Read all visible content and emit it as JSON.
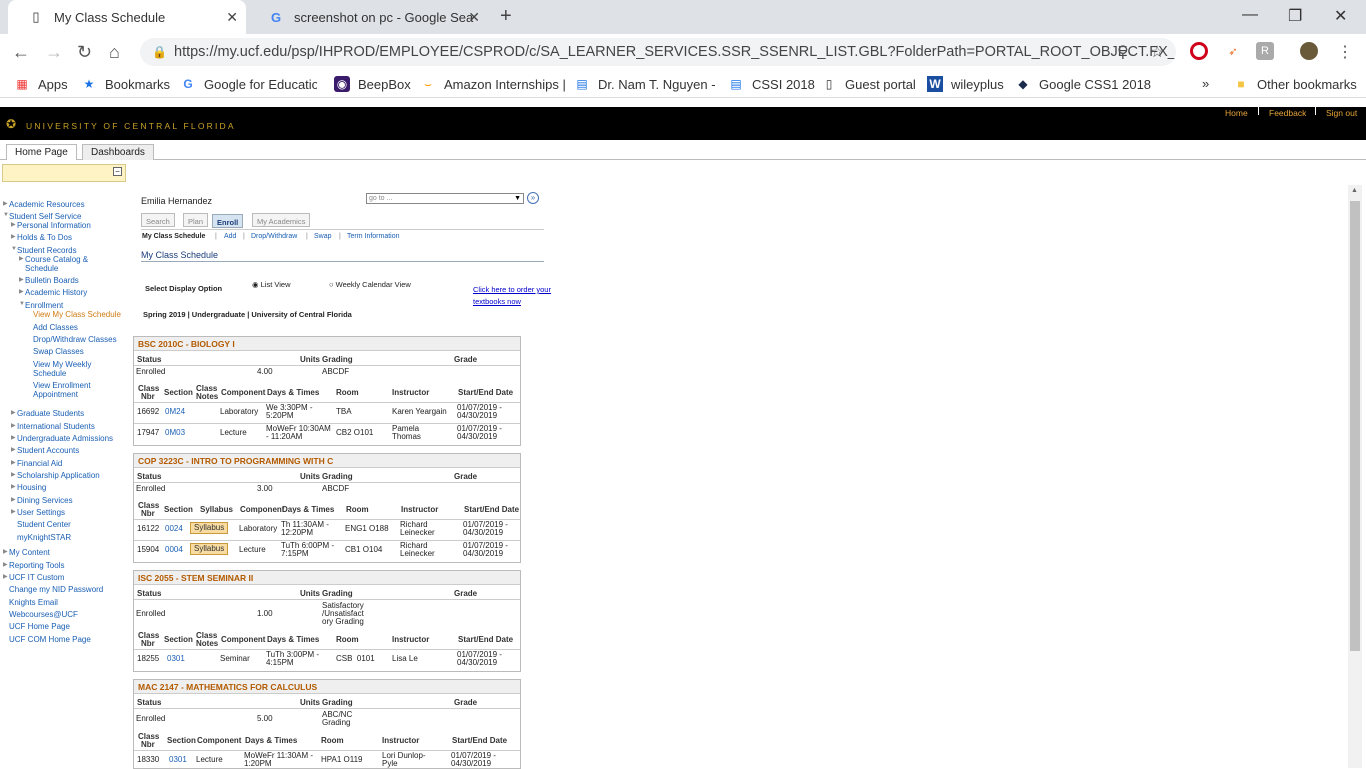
{
  "browser": {
    "tabs": [
      {
        "title": "My Class Schedule",
        "icon": "page-icon"
      },
      {
        "title": "screenshot on pc - Google Search",
        "icon": "google-icon"
      }
    ],
    "new_tab": "+",
    "url": "https://my.ucf.edu/psp/IHPROD/EMPLOYEE/CSPROD/c/SA_LEARNER_SERVICES.SSR_SSENRL_LIST.GBL?FolderPath=PORTAL_ROOT_OBJECT.FX_STUDE...",
    "bookmarks": [
      {
        "label": "Apps",
        "icon": "apps-icon"
      },
      {
        "label": "Bookmarks",
        "icon": "star-icon"
      },
      {
        "label": "Google for Education",
        "icon": "google-icon"
      },
      {
        "label": "BeepBox",
        "icon": "beepbox-icon"
      },
      {
        "label": "Amazon Internships |",
        "icon": "amazon-icon"
      },
      {
        "label": "Dr. Nam T. Nguyen -",
        "icon": "calendar-icon"
      },
      {
        "label": "CSSI 2018",
        "icon": "calendar-icon"
      },
      {
        "label": "Guest portal",
        "icon": "page-icon"
      },
      {
        "label": "wileyplus",
        "icon": "w-icon"
      },
      {
        "label": "Google CSS1 2018 -",
        "icon": "diamond-icon"
      }
    ],
    "bookmarks_overflow": "»",
    "other_bookmarks": "Other bookmarks"
  },
  "portal": {
    "university": "UNIVERSITY OF CENTRAL FLORIDA",
    "header_links": [
      "Home",
      "Feedback",
      "Sign out"
    ],
    "tabs": [
      "Home Page",
      "Dashboards"
    ]
  },
  "nav": [
    {
      "label": "Academic Resources"
    },
    {
      "label": "Student Self Service"
    },
    {
      "label": "Personal Information"
    },
    {
      "label": "Holds & To Dos"
    },
    {
      "label": "Student Records"
    },
    {
      "label": "Course Catalog &"
    },
    {
      "label": "Schedule"
    },
    {
      "label": "Bulletin Boards"
    },
    {
      "label": "Academic History"
    },
    {
      "label": "Enrollment"
    },
    {
      "label": "View My Class Schedule"
    },
    {
      "label": "Add Classes"
    },
    {
      "label": "Drop/Withdraw Classes"
    },
    {
      "label": "Swap Classes"
    },
    {
      "label": "View My Weekly"
    },
    {
      "label": "Schedule"
    },
    {
      "label": "View Enrollment"
    },
    {
      "label": "Appointment"
    },
    {
      "label": "Graduate Students"
    },
    {
      "label": "International Students"
    },
    {
      "label": "Undergraduate Admissions"
    },
    {
      "label": "Student Accounts"
    },
    {
      "label": "Financial Aid"
    },
    {
      "label": "Scholarship Application"
    },
    {
      "label": "Housing"
    },
    {
      "label": "Dining Services"
    },
    {
      "label": "User Settings"
    },
    {
      "label": "Student Center"
    },
    {
      "label": "myKnightSTAR"
    },
    {
      "label": "My Content"
    },
    {
      "label": "Reporting Tools"
    },
    {
      "label": "UCF IT Custom"
    },
    {
      "label": "Change my NID Password"
    },
    {
      "label": "Knights Email"
    },
    {
      "label": "Webcourses@UCF"
    },
    {
      "label": "UCF Home Page"
    },
    {
      "label": "UCF COM Home Page"
    }
  ],
  "main": {
    "student_name": "Emilia Hernandez",
    "goto_placeholder": "go to ...",
    "tabs": [
      "Search",
      "Plan",
      "Enroll",
      "My Academics"
    ],
    "sublinks": [
      "My Class Schedule",
      "Add",
      "Drop/Withdraw",
      "Swap",
      "Term Information"
    ],
    "sublink_sep": "|",
    "page_title": "My Class Schedule",
    "display_option_label": "Select Display Option",
    "list_view": "List View",
    "weekly_view": "Weekly Calendar View",
    "textbook_link_1": "Click here to order your",
    "textbook_link_2": "textbooks now",
    "term": "Spring 2019 | Undergraduate | University of Central Florida"
  },
  "labels": {
    "status": "Status",
    "units": "Units",
    "grading": "Grading",
    "grade": "Grade",
    "class": "Class",
    "nbr": "Nbr",
    "section": "Section",
    "class_notes_1": "Class",
    "class_notes_2": "Notes",
    "syllabus": "Syllabus",
    "component": "Component",
    "days_times": "Days & Times",
    "room": "Room",
    "instructor": "Instructor",
    "start_end": "Start/End Date"
  },
  "courses": [
    {
      "title": "BSC 2010C - BIOLOGY I",
      "status": "Enrolled",
      "units": "4.00",
      "grading": "ABCDF",
      "classes": [
        {
          "nbr": "16692",
          "section": "0M24",
          "component": "Laboratory",
          "days1": "We 3:30PM -",
          "days2": "5:20PM",
          "room": "TBA",
          "instr1": "Karen Yeargain",
          "instr2": "",
          "date1": "01/07/2019 -",
          "date2": "04/30/2019"
        },
        {
          "nbr": "17947",
          "section": "0M03",
          "component": "Lecture",
          "days1": "MoWeFr 10:30AM",
          "days2": "- 11:20AM",
          "room": "CB2 O101",
          "instr1": "Pamela",
          "instr2": "Thomas",
          "date1": "01/07/2019 -",
          "date2": "04/30/2019"
        }
      ]
    },
    {
      "title": "COP 3223C - INTRO TO PROGRAMMING WITH C",
      "status": "Enrolled",
      "units": "3.00",
      "grading": "ABCDF",
      "classes": [
        {
          "nbr": "16122",
          "section": "0024",
          "component": "Laboratory",
          "days1": "Th 11:30AM -",
          "days2": "12:20PM",
          "room": "ENG1 O188",
          "instr1": "Richard",
          "instr2": "Leinecker",
          "date1": "01/07/2019 -",
          "date2": "04/30/2019"
        },
        {
          "nbr": "15904",
          "section": "0004",
          "component": "Lecture",
          "days1": "TuTh 6:00PM -",
          "days2": "7:15PM",
          "room": "CB1 O104",
          "instr1": "Richard",
          "instr2": "Leinecker",
          "date1": "01/07/2019 -",
          "date2": "04/30/2019"
        }
      ]
    },
    {
      "title": "ISC 2055 - STEM SEMINAR II",
      "status": "Enrolled",
      "units": "1.00",
      "grading1": "Satisfactory",
      "grading2": "/Unsatisfact",
      "grading3": "ory Grading",
      "classes": [
        {
          "nbr": "18255",
          "section": "0301",
          "component": "Seminar",
          "days1": "TuTh 3:00PM -",
          "days2": "4:15PM",
          "room": "CSB  0101",
          "instr1": "Lisa Le",
          "instr2": "",
          "date1": "01/07/2019 -",
          "date2": "04/30/2019"
        }
      ]
    },
    {
      "title": "MAC 2147 - MATHEMATICS FOR CALCULUS",
      "status": "Enrolled",
      "units": "5.00",
      "grading1": "ABC/NC",
      "grading2": "Grading",
      "classes": [
        {
          "nbr": "18330",
          "section": "0301",
          "component": "Lecture",
          "days1": "MoWeFr 11:30AM -",
          "days2": "1:20PM",
          "room": "HPA1 O119",
          "instr1": "Lori Dunlop-",
          "instr2": "Pyle",
          "date1": "01/07/2019 -",
          "date2": "04/30/2019"
        }
      ]
    }
  ]
}
